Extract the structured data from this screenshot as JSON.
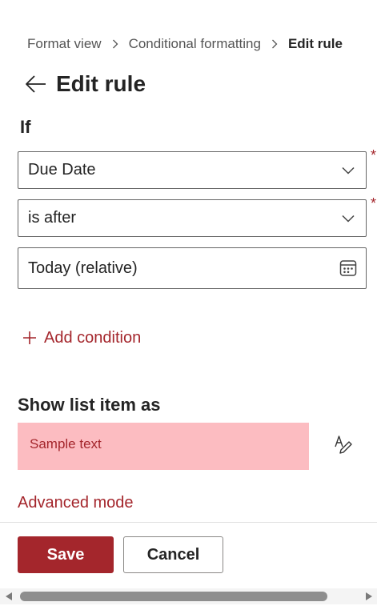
{
  "breadcrumb": {
    "items": [
      "Format view",
      "Conditional formatting"
    ],
    "current": "Edit rule"
  },
  "header": {
    "title": "Edit rule"
  },
  "if_section": {
    "heading": "If",
    "field_select": {
      "value": "Due Date",
      "required_mark": "*"
    },
    "operator_select": {
      "value": "is after",
      "required_mark": "*"
    },
    "value_input": {
      "value": "Today (relative)"
    },
    "add_condition_label": "Add condition"
  },
  "show_section": {
    "heading": "Show list item as",
    "sample_text": "Sample text",
    "sample_bg": "#fcbcc1",
    "sample_fg": "#a4262c"
  },
  "advanced_mode_label": "Advanced mode",
  "actions": {
    "save_label": "Save",
    "cancel_label": "Cancel"
  },
  "colors": {
    "accent": "#a4262c",
    "text": "#242424",
    "border": "#666666"
  },
  "icons": [
    "chevron-right-icon",
    "back-arrow-icon",
    "chevron-down-icon",
    "calendar-icon",
    "plus-icon",
    "text-style-icon"
  ]
}
